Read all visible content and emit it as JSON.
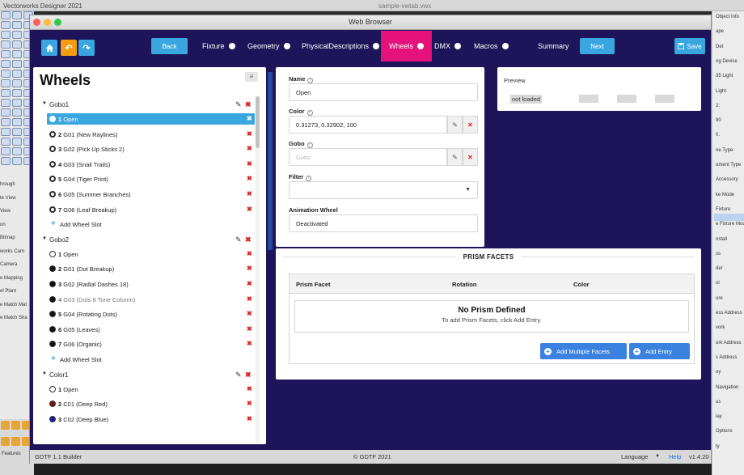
{
  "host": {
    "title": "Vectorworks Designer 2021",
    "file": "sample-vwtab.vwx",
    "left_labels": [
      "hrough",
      "te View",
      "View",
      "",
      "on",
      "Bitmap",
      "works Cam",
      "Camera",
      "e Mapping",
      "el Plant",
      "e Match Mat",
      "e Match Sha"
    ],
    "left_bottom_label": "Features",
    "right_labels": [
      "Object Info",
      "ape",
      "Det",
      "ng Device",
      "35 Light",
      "Light",
      "2:",
      "90",
      "0.",
      "ne Type",
      "ument Type",
      "Accessory",
      "ke Mode",
      "Fixture",
      "e Fixture Mod",
      "nstall",
      "ss",
      "der",
      "ol",
      "ure",
      "ess Address",
      "vork",
      "ork Address",
      "s Address",
      "oy",
      "Navigation",
      "us",
      "lay",
      "Options",
      "ty"
    ]
  },
  "window": {
    "title": "Web Browser"
  },
  "nav": {
    "home_icon": "home-icon",
    "undo_icon": "undo-icon",
    "redo_icon": "redo-icon",
    "back_label": "Back",
    "next_label": "Next",
    "save_label": "Save",
    "save_icon": "floppy-disk-icon",
    "tabs": [
      {
        "label": "Fixture"
      },
      {
        "label": "Geometry"
      },
      {
        "label": "PhysicalDescriptions"
      },
      {
        "label": "Wheels"
      },
      {
        "label": "DMX"
      },
      {
        "label": "Macros"
      },
      {
        "label": "Summary"
      }
    ],
    "active_tab": "Wheels",
    "colors": {
      "bg": "#1e1459",
      "active_tab": "#e5127c",
      "button": "#3aa6e0",
      "undo": "#f39c12"
    }
  },
  "wheels_panel": {
    "title": "Wheels",
    "menu_icon": "hamburger-icon",
    "groups": [
      {
        "name": "Gobo1",
        "slots": [
          {
            "num": "1",
            "name": "Open",
            "selected": true,
            "swatch": "open"
          },
          {
            "num": "2",
            "name": "G01 (New Raylines)",
            "swatch": "gobo"
          },
          {
            "num": "3",
            "name": "G02 (Pick Up Sticks 2)",
            "swatch": "gobo"
          },
          {
            "num": "4",
            "name": "G03 (Snail Trails)",
            "swatch": "gobo"
          },
          {
            "num": "5",
            "name": "G04 (Tiger Print)",
            "swatch": "gobo"
          },
          {
            "num": "6",
            "name": "G05 (Summer Branches)",
            "swatch": "gobo"
          },
          {
            "num": "7",
            "name": "G06 (Leaf Breakup)",
            "swatch": "gobo"
          }
        ],
        "add_label": "Add Wheel Slot"
      },
      {
        "name": "Gobo2",
        "slots": [
          {
            "num": "1",
            "name": "Open",
            "swatch": "open"
          },
          {
            "num": "2",
            "name": "G01 (Dot Breakup)",
            "swatch": "dark"
          },
          {
            "num": "3",
            "name": "G02 (Radial Dashes 18)",
            "swatch": "dark"
          },
          {
            "num": "4",
            "name": "G03 (Dots 8 Tone Column)",
            "swatch": "dark",
            "dim": true
          },
          {
            "num": "5",
            "name": "G04 (Rotating Dots)",
            "swatch": "dark"
          },
          {
            "num": "6",
            "name": "G05 (Leaves)",
            "swatch": "dark"
          },
          {
            "num": "7",
            "name": "G06 (Organic)",
            "swatch": "dark"
          }
        ],
        "add_label": "Add Wheel Slot"
      },
      {
        "name": "Color1",
        "slots": [
          {
            "num": "1",
            "name": "Open",
            "swatch": "open"
          },
          {
            "num": "2",
            "name": "C01 (Deep Red)",
            "swatch": "#7a1010"
          },
          {
            "num": "3",
            "name": "C02 (Deep Blue)",
            "swatch": "#1a1aa8"
          }
        ]
      }
    ]
  },
  "form": {
    "name_label": "Name",
    "name_value": "Open",
    "color_label": "Color",
    "color_value": "0.31273, 0.32902, 100",
    "gobo_label": "Gobo",
    "gobo_placeholder": "Gobo",
    "filter_label": "Filter",
    "filter_value": "",
    "animation_label": "Animation Wheel",
    "animation_value": "Deactivated"
  },
  "preview": {
    "label": "Preview",
    "not_loaded": "not loaded"
  },
  "prism": {
    "title": "PRISM FACETS",
    "col_facet": "Prism Facet",
    "col_rotation": "Rotation",
    "col_color": "Color",
    "empty_title": "No Prism Defined",
    "empty_hint": "To add Prism Facets, click Add Entry.",
    "add_multiple_label": "Add Multiple Facets",
    "add_entry_label": "Add Entry"
  },
  "footer": {
    "left": "GDTF 1.1 Builder",
    "center": "© GDTF 2021",
    "language": "Language",
    "help": "Help",
    "version": "v1.4.20"
  }
}
